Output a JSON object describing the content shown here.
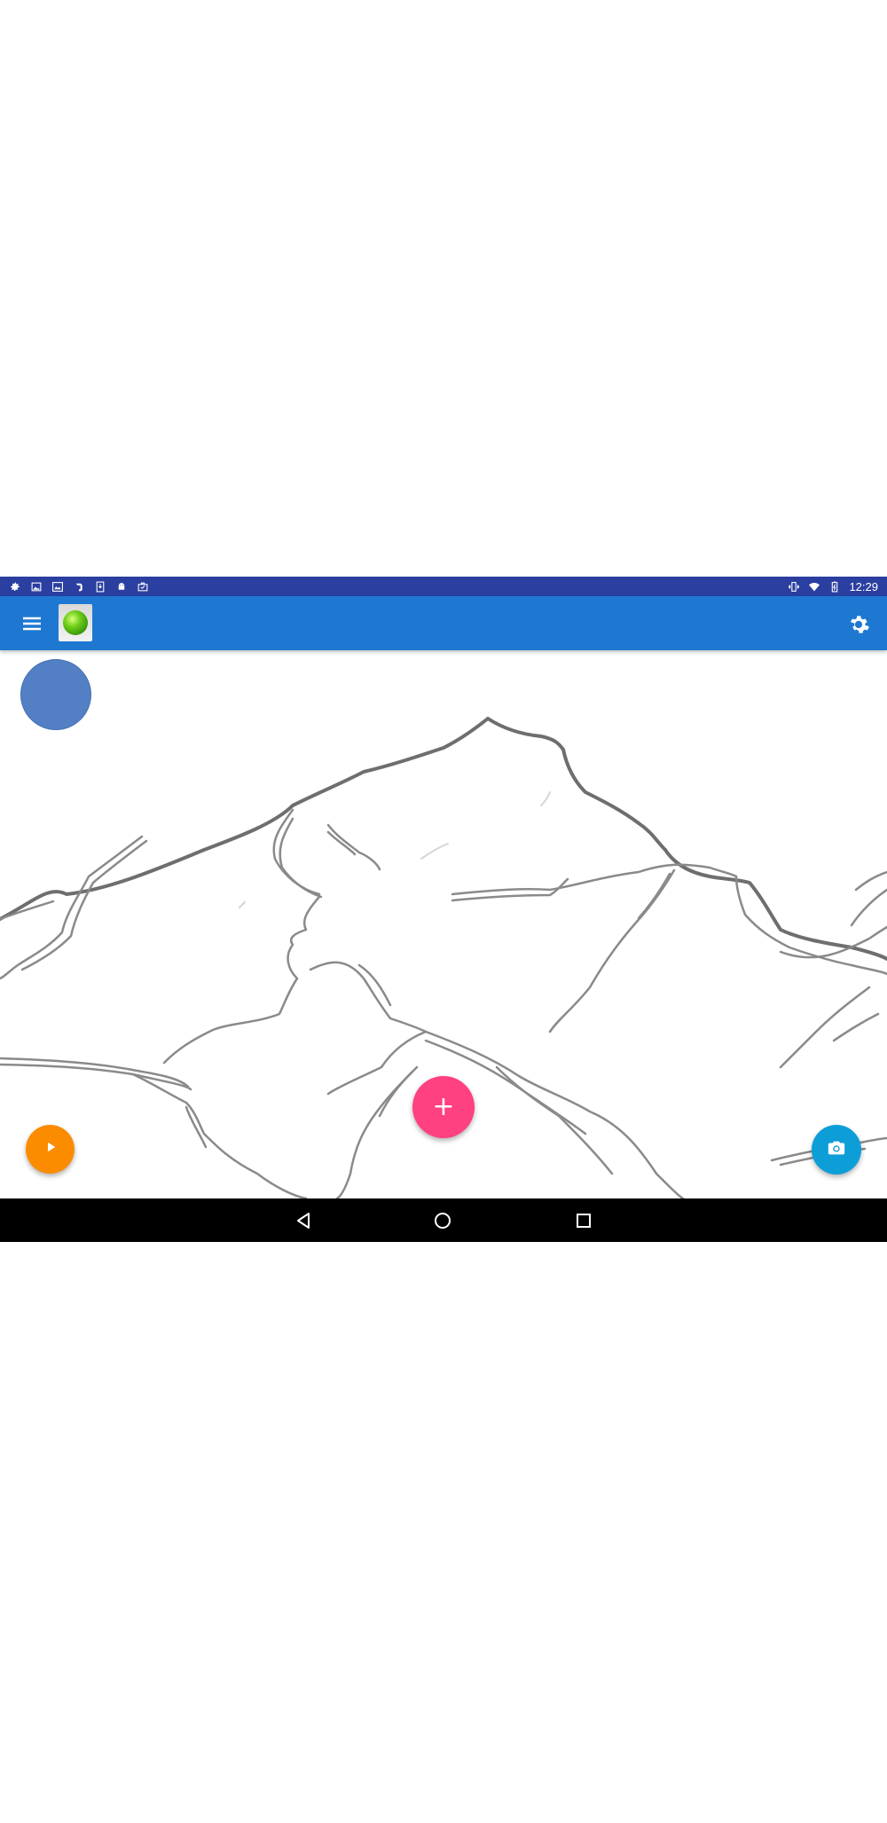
{
  "status_bar": {
    "time": "12:29",
    "left_icons": [
      "gear-icon",
      "image-icon",
      "gallery-icon",
      "evernote-icon",
      "download-icon",
      "android-icon",
      "briefcase-icon"
    ],
    "right_icons": [
      "vibrate-icon",
      "wifi-icon",
      "battery-icon"
    ],
    "background": "#2a3fa0"
  },
  "app_bar": {
    "background": "#1e78d2",
    "menu_icon": "hamburger-menu-icon",
    "logo": "app-logo-icon",
    "settings_icon": "gear-icon"
  },
  "canvas": {
    "subject": "mountain-sketch",
    "selected_color": "#5380c4"
  },
  "fabs": {
    "play": {
      "icon": "play-icon",
      "color": "#fb8c00"
    },
    "add": {
      "icon": "plus-icon",
      "label": "+",
      "color": "#ff4081"
    },
    "camera": {
      "icon": "camera-icon",
      "color": "#0d9ed8"
    }
  },
  "nav_bar": {
    "back_icon": "back-triangle-icon",
    "home_icon": "home-circle-icon",
    "recents_icon": "recents-square-icon"
  }
}
